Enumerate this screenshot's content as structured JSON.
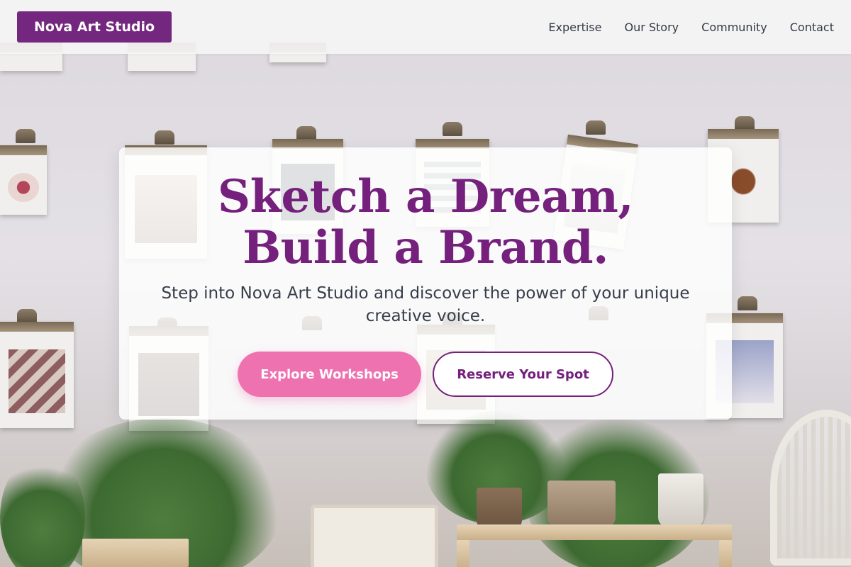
{
  "header": {
    "brand": "Nova Art Studio",
    "nav": [
      {
        "label": "Expertise"
      },
      {
        "label": "Our Story"
      },
      {
        "label": "Community"
      },
      {
        "label": "Contact"
      }
    ]
  },
  "hero": {
    "headline": "Sketch a Dream, Build a Brand.",
    "subheadline": "Step into Nova Art Studio and discover the power of your unique creative voice.",
    "primary_cta": "Explore Workshops",
    "secondary_cta": "Reserve Your Spot"
  },
  "colors": {
    "brand_purple": "#74277e",
    "headline_purple": "#74207c",
    "pink_accent": "#ef72b0",
    "body_text": "#363d49"
  },
  "background": {
    "description_icon": "studio-wall-photo"
  }
}
